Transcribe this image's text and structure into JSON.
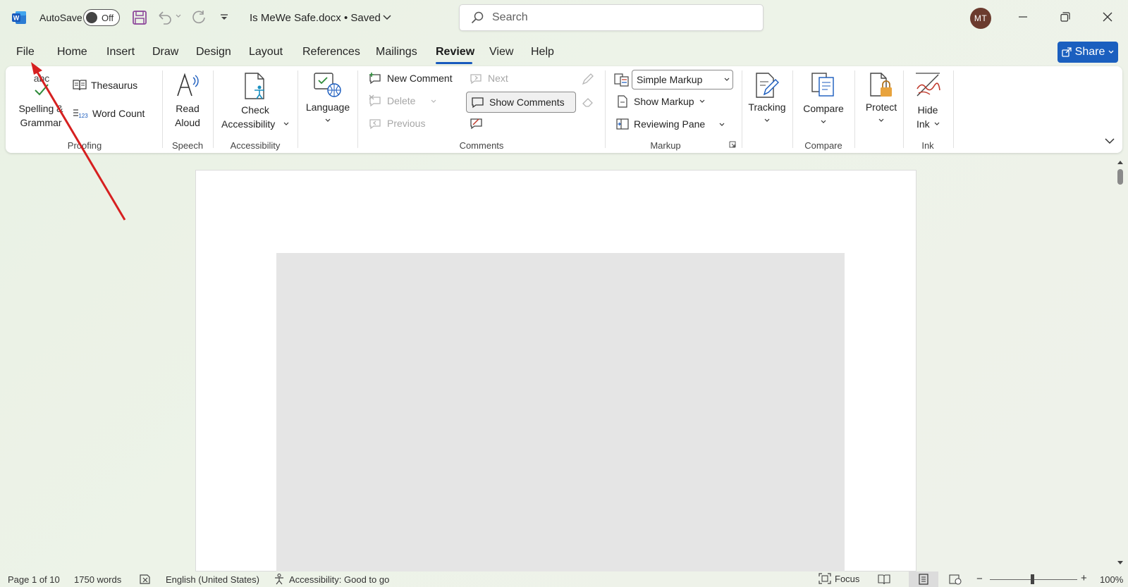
{
  "titlebar": {
    "autosave_label": "AutoSave",
    "autosave_state": "Off",
    "doc_title": "Is MeWe Safe.docx • Saved",
    "search_placeholder": "Search",
    "avatar_initials": "MT"
  },
  "menu": {
    "tabs": [
      "File",
      "Home",
      "Insert",
      "Draw",
      "Design",
      "Layout",
      "References",
      "Mailings",
      "Review",
      "View",
      "Help"
    ],
    "active_tab": "Review",
    "share_label": "Share"
  },
  "ribbon": {
    "proofing": {
      "spelling_l1": "Spelling &",
      "spelling_l2": "Grammar",
      "spelling_icon_text": "abc",
      "thesaurus": "Thesaurus",
      "word_count": "Word Count",
      "word_count_icon_text": "123",
      "group": "Proofing"
    },
    "speech": {
      "read_l1": "Read",
      "read_l2": "Aloud",
      "group": "Speech"
    },
    "accessibility": {
      "check_l1": "Check",
      "check_l2": "Accessibility",
      "group": "Accessibility"
    },
    "language": {
      "label": "Language"
    },
    "comments": {
      "new_comment": "New Comment",
      "delete": "Delete",
      "previous": "Previous",
      "next": "Next",
      "show_comments": "Show Comments",
      "group": "Comments"
    },
    "markup": {
      "simple_markup": "Simple Markup",
      "show_markup": "Show Markup",
      "reviewing_pane": "Reviewing Pane",
      "group": "Markup"
    },
    "tracking": {
      "label": "Tracking"
    },
    "compare": {
      "label": "Compare",
      "group": "Compare"
    },
    "protect": {
      "label": "Protect"
    },
    "ink": {
      "hide_l1": "Hide",
      "hide_l2": "Ink",
      "group": "Ink"
    }
  },
  "statusbar": {
    "page": "Page 1 of 10",
    "words": "1750 words",
    "language": "English (United States)",
    "accessibility": "Accessibility: Good to go",
    "focus": "Focus",
    "zoom": "100%",
    "zoom_level_percent": 100
  },
  "colors": {
    "accent": "#185abd",
    "share_button": "#1b5fbf",
    "annotation_arrow": "#d62020"
  }
}
